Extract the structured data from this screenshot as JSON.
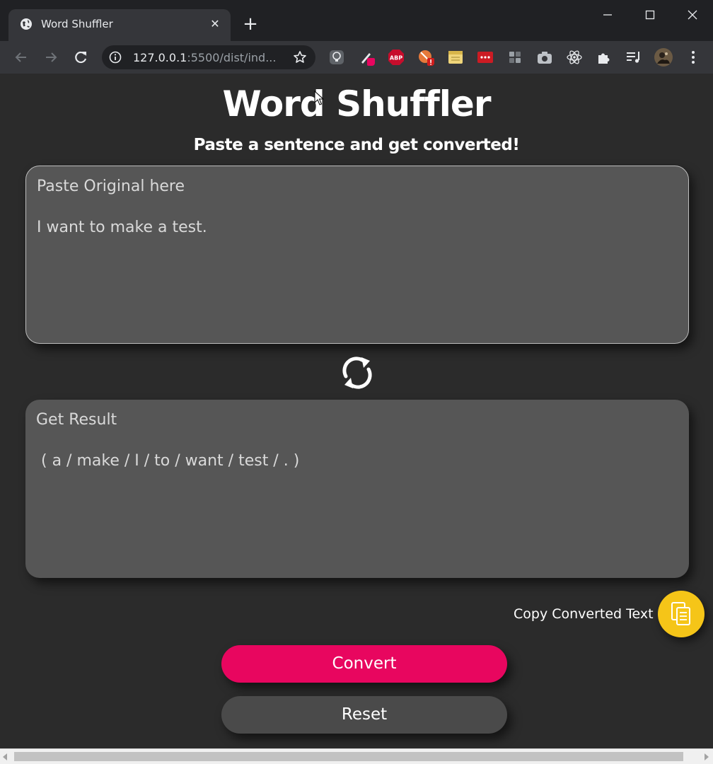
{
  "browser": {
    "tab_title": "Word Shuffler",
    "new_tab_symbol": "+",
    "url_host": "127.0.0.1",
    "url_rest": ":5500/dist/ind...",
    "extensions": [
      "lightbulb-ext-icon",
      "pen-ext-icon",
      "adblock-plus-icon",
      "block-ext-icon",
      "notes-ext-icon",
      "password-ext-icon",
      "tiles-ext-icon",
      "camera-ext-icon",
      "react-devtools-icon",
      "puzzle-extensions-icon",
      "media-controls-icon",
      "profile-avatar"
    ],
    "adblock_label": "ABP"
  },
  "page": {
    "title": "Word Shuffler",
    "subtitle": "Paste a sentence and get converted!",
    "input": {
      "label": "Paste Original here",
      "value": "I want to make a test."
    },
    "output": {
      "label": "Get Result",
      "value": " ( a / make / I / to / want / test / . )"
    },
    "copy_label": "Copy Converted Text",
    "convert_label": "Convert",
    "reset_label": "Reset"
  },
  "colors": {
    "background": "#2b2b2b",
    "box": "#565656",
    "convert": "#e8065f",
    "reset": "#4a4a4a",
    "copy": "#f5c518"
  }
}
